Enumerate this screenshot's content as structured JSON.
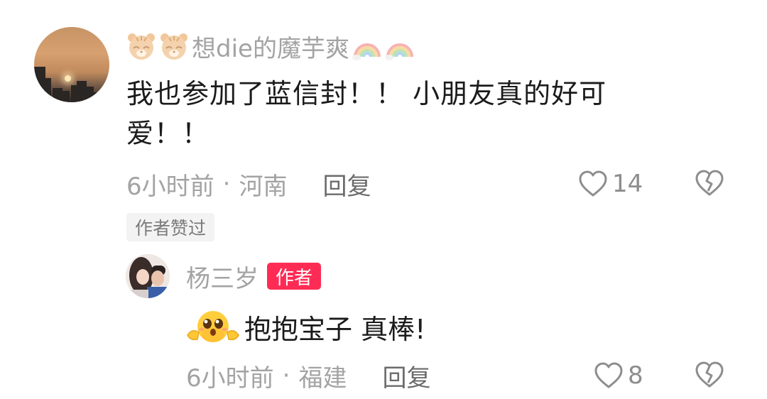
{
  "comment": {
    "username": "想die的魔芋爽",
    "text": "我也参加了蓝信封！！ 小朋友真的好可爱！！",
    "time": "6小时前",
    "separator": "·",
    "location": "河南",
    "reply_label": "回复",
    "like_count": "14",
    "author_liked_label": "作者赞过",
    "username_prefix_icons": [
      "tiger-face-icon",
      "tiger-face-icon"
    ],
    "username_suffix_icons": [
      "rainbow-icon",
      "rainbow-icon"
    ]
  },
  "reply": {
    "username": "杨三岁",
    "author_badge": "作者",
    "emoji": "hug-emoji",
    "text": "抱抱宝子 真棒!",
    "time": "6小时前",
    "separator": "·",
    "location": "福建",
    "reply_label": "回复",
    "like_count": "8"
  },
  "colors": {
    "primary_text": "#1b1b1b",
    "secondary_text": "#a3a3a3",
    "author_badge_bg": "#fe2c55",
    "author_liked_bg": "#f3f3f3"
  }
}
